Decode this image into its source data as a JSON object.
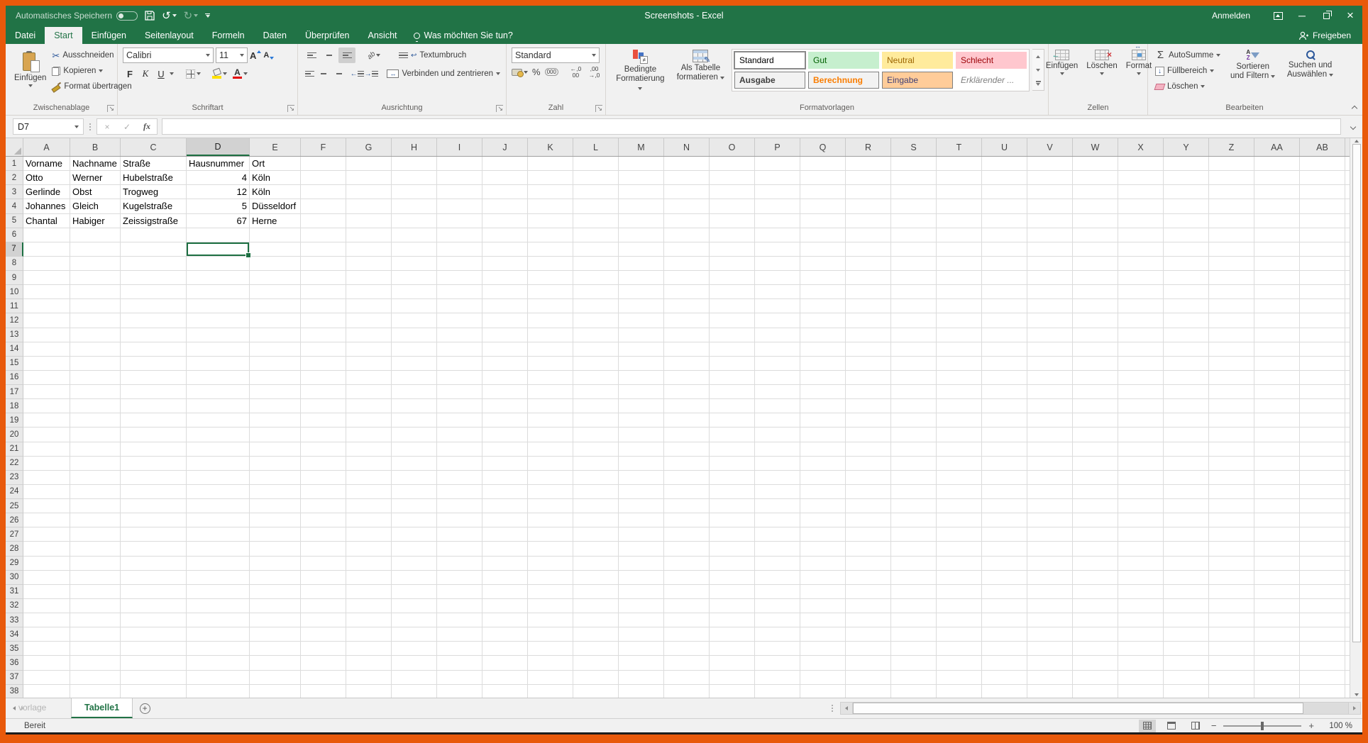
{
  "window": {
    "title": "Screenshots  -  Excel",
    "autosave_label": "Automatisches Speichern",
    "signin": "Anmelden",
    "share": "Freigeben"
  },
  "ribbon": {
    "tabs": [
      "Datei",
      "Start",
      "Einfügen",
      "Seitenlayout",
      "Formeln",
      "Daten",
      "Überprüfen",
      "Ansicht"
    ],
    "active_tab": "Start",
    "tell_me": "Was möchten Sie tun?",
    "groups": {
      "clipboard": {
        "label": "Zwischenablage",
        "paste": "Einfügen",
        "cut": "Ausschneiden",
        "copy": "Kopieren",
        "format_painter": "Format übertragen"
      },
      "font": {
        "label": "Schriftart",
        "font_name": "Calibri",
        "font_size": "11",
        "bold": "F",
        "italic": "K",
        "underline": "U"
      },
      "alignment": {
        "label": "Ausrichtung",
        "wrap_text": "Textumbruch",
        "merge_center": "Verbinden und zentrieren"
      },
      "number": {
        "label": "Zahl",
        "format": "Standard",
        "thousands": "000",
        "percent": "%",
        "dec_inc": "←,0 00",
        "dec_dec": ",00 →,0"
      },
      "styles": {
        "label": "Formatvorlagen",
        "conditional": "Bedingte Formatierung",
        "as_table": "Als Tabelle formatieren",
        "gallery": [
          {
            "label": "Standard",
            "bg": "#ffffff",
            "fg": "#000000",
            "selected": true
          },
          {
            "label": "Gut",
            "bg": "#c6efce",
            "fg": "#006100"
          },
          {
            "label": "Neutral",
            "bg": "#ffeb9c",
            "fg": "#9c6500"
          },
          {
            "label": "Schlecht",
            "bg": "#ffc7ce",
            "fg": "#9c0006"
          },
          {
            "label": "Ausgabe",
            "bg": "#f2f2f2",
            "fg": "#3f3f3f",
            "boxed": true,
            "bold": true
          },
          {
            "label": "Berechnung",
            "bg": "#f2f2f2",
            "fg": "#fa7d00",
            "boxed": true,
            "bold": true
          },
          {
            "label": "Eingabe",
            "bg": "#ffcc99",
            "fg": "#3f3f76",
            "boxed": true
          },
          {
            "label": "Erklärender ...",
            "bg": "#ffffff",
            "fg": "#7f7f7f",
            "italic": true
          }
        ]
      },
      "cells": {
        "label": "Zellen",
        "insert": "Einfügen",
        "delete": "Löschen",
        "format": "Format"
      },
      "editing": {
        "label": "Bearbeiten",
        "autosum": "AutoSumme",
        "fill": "Füllbereich",
        "clear": "Löschen",
        "sort": "Sortieren und Filtern",
        "find": "Suchen und Auswählen"
      }
    }
  },
  "formula_bar": {
    "name_box": "D7",
    "fx_label": "fx"
  },
  "sheet": {
    "columns": [
      "A",
      "B",
      "C",
      "D",
      "E",
      "F",
      "G",
      "H",
      "I",
      "J",
      "K",
      "L",
      "M",
      "N",
      "O",
      "P",
      "Q",
      "R",
      "S",
      "T",
      "U",
      "V",
      "W",
      "X",
      "Y",
      "Z",
      "AA",
      "AB"
    ],
    "row_count": 38,
    "selection": {
      "cell": "D7",
      "column": "D",
      "row": 7
    },
    "table": [
      [
        "Vorname",
        "Nachname",
        "Straße",
        "Hausnummer",
        "Ort"
      ],
      [
        "Otto",
        "Werner",
        "Hubelstraße",
        "4",
        "Köln"
      ],
      [
        "Gerlinde",
        "Obst",
        "Trogweg",
        "12",
        "Köln"
      ],
      [
        "Johannes",
        "Gleich",
        "Kugelstraße",
        "5",
        "Düsseldorf"
      ],
      [
        "Chantal",
        "Habiger",
        "Zeissigstraße",
        "67",
        "Herne"
      ]
    ],
    "active_tab": "Tabelle1",
    "watermark": "vorlage"
  },
  "status_bar": {
    "mode": "Bereit",
    "zoom": "100 %"
  }
}
